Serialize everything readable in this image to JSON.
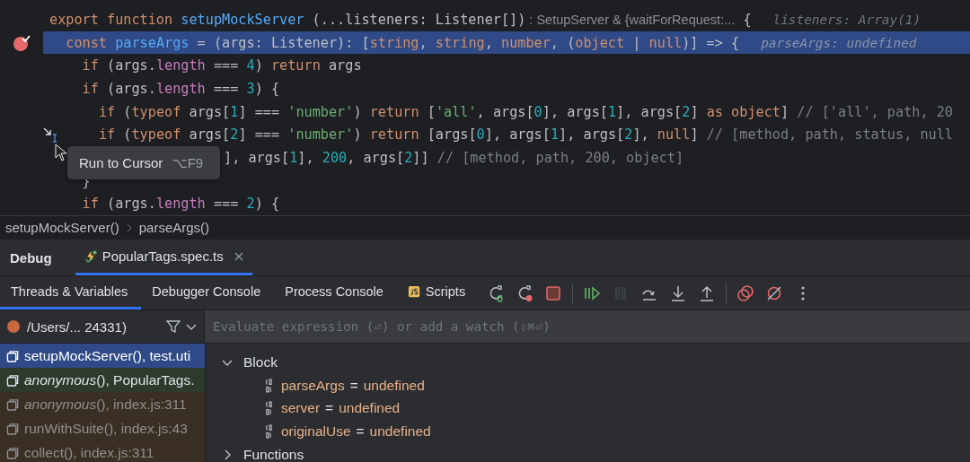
{
  "editor": {
    "lines": [
      {
        "current": false,
        "breakpoint": false,
        "tokens": [
          {
            "kind": "keyword",
            "text": "export function "
          },
          {
            "kind": "function",
            "text": "setupMockServer"
          },
          {
            "kind": "plain",
            "text": " (...listeners: Listener[])"
          },
          {
            "kind": "hint",
            "text": ": SetupServer & {waitForRequest:..."
          },
          {
            "kind": "plain",
            "text": " {"
          },
          {
            "kind": "inline",
            "text": "listeners: Array(1)"
          }
        ]
      },
      {
        "current": true,
        "breakpoint": true,
        "tokens": [
          {
            "kind": "keyword",
            "text": "  const "
          },
          {
            "kind": "function",
            "text": "parseArgs"
          },
          {
            "kind": "plain",
            "text": " = (args: Listener): ["
          },
          {
            "kind": "keyword",
            "text": "string"
          },
          {
            "kind": "plain",
            "text": ", "
          },
          {
            "kind": "keyword",
            "text": "string"
          },
          {
            "kind": "plain",
            "text": ", "
          },
          {
            "kind": "keyword",
            "text": "number"
          },
          {
            "kind": "plain",
            "text": ", ("
          },
          {
            "kind": "keyword",
            "text": "object"
          },
          {
            "kind": "plain",
            "text": " | "
          },
          {
            "kind": "keyword",
            "text": "null"
          },
          {
            "kind": "plain",
            "text": ")] => {"
          },
          {
            "kind": "inline",
            "text": "parseArgs: undefined"
          }
        ]
      },
      {
        "current": false,
        "breakpoint": false,
        "tokens": [
          {
            "kind": "keyword",
            "text": "    if"
          },
          {
            "kind": "plain",
            "text": " (args."
          },
          {
            "kind": "property",
            "text": "length"
          },
          {
            "kind": "plain",
            "text": " === "
          },
          {
            "kind": "number",
            "text": "4"
          },
          {
            "kind": "plain",
            "text": ") "
          },
          {
            "kind": "keyword",
            "text": "return"
          },
          {
            "kind": "plain",
            "text": " args"
          }
        ]
      },
      {
        "current": false,
        "breakpoint": false,
        "tokens": [
          {
            "kind": "keyword",
            "text": "    if"
          },
          {
            "kind": "plain",
            "text": " (args."
          },
          {
            "kind": "property",
            "text": "length"
          },
          {
            "kind": "plain",
            "text": " === "
          },
          {
            "kind": "number",
            "text": "3"
          },
          {
            "kind": "plain",
            "text": ") {"
          }
        ]
      },
      {
        "current": false,
        "breakpoint": false,
        "tokens": [
          {
            "kind": "keyword",
            "text": "      if"
          },
          {
            "kind": "plain",
            "text": " ("
          },
          {
            "kind": "keyword",
            "text": "typeof"
          },
          {
            "kind": "plain",
            "text": " args["
          },
          {
            "kind": "number",
            "text": "1"
          },
          {
            "kind": "plain",
            "text": "] === "
          },
          {
            "kind": "string",
            "text": "'number'"
          },
          {
            "kind": "plain",
            "text": ") "
          },
          {
            "kind": "keyword",
            "text": "return"
          },
          {
            "kind": "plain",
            "text": " ["
          },
          {
            "kind": "string",
            "text": "'all'"
          },
          {
            "kind": "plain",
            "text": ", args["
          },
          {
            "kind": "number",
            "text": "0"
          },
          {
            "kind": "plain",
            "text": "], args["
          },
          {
            "kind": "number",
            "text": "1"
          },
          {
            "kind": "plain",
            "text": "], args["
          },
          {
            "kind": "number",
            "text": "2"
          },
          {
            "kind": "plain",
            "text": "] "
          },
          {
            "kind": "keyword",
            "text": "as object"
          },
          {
            "kind": "plain",
            "text": "] "
          },
          {
            "kind": "comment",
            "text": "// ['all', path, 20"
          }
        ]
      },
      {
        "current": false,
        "breakpoint": false,
        "run_to_cursor": true,
        "tokens": [
          {
            "kind": "keyword",
            "text": "      if"
          },
          {
            "kind": "plain",
            "text": " ("
          },
          {
            "kind": "keyword",
            "text": "typeof"
          },
          {
            "kind": "plain",
            "text": " args["
          },
          {
            "kind": "number",
            "text": "2"
          },
          {
            "kind": "plain",
            "text": "] === "
          },
          {
            "kind": "string",
            "text": "'number'"
          },
          {
            "kind": "plain",
            "text": ") "
          },
          {
            "kind": "keyword",
            "text": "return"
          },
          {
            "kind": "plain",
            "text": " [args["
          },
          {
            "kind": "number",
            "text": "0"
          },
          {
            "kind": "plain",
            "text": "], args["
          },
          {
            "kind": "number",
            "text": "1"
          },
          {
            "kind": "plain",
            "text": "], args["
          },
          {
            "kind": "number",
            "text": "2"
          },
          {
            "kind": "plain",
            "text": "], "
          },
          {
            "kind": "keyword",
            "text": "null"
          },
          {
            "kind": "plain",
            "text": "] "
          },
          {
            "kind": "comment",
            "text": "// [method, path, status, null"
          }
        ]
      },
      {
        "current": false,
        "breakpoint": false,
        "covered": true,
        "tokens": [
          {
            "kind": "plain",
            "text": "], args["
          },
          {
            "kind": "number",
            "text": "1"
          },
          {
            "kind": "plain",
            "text": "], "
          },
          {
            "kind": "number",
            "text": "200"
          },
          {
            "kind": "plain",
            "text": ", args["
          },
          {
            "kind": "number",
            "text": "2"
          },
          {
            "kind": "plain",
            "text": "]] "
          },
          {
            "kind": "comment",
            "text": "// [method, path, 200, object]"
          }
        ]
      },
      {
        "current": false,
        "breakpoint": false,
        "tokens": [
          {
            "kind": "plain",
            "text": "    }"
          }
        ]
      },
      {
        "current": false,
        "breakpoint": false,
        "tokens": [
          {
            "kind": "keyword",
            "text": "    if"
          },
          {
            "kind": "plain",
            "text": " (args."
          },
          {
            "kind": "property",
            "text": "length"
          },
          {
            "kind": "plain",
            "text": " === "
          },
          {
            "kind": "number",
            "text": "2"
          },
          {
            "kind": "plain",
            "text": ") {"
          }
        ]
      }
    ],
    "tooltip": {
      "label": "Run to Cursor",
      "shortcut": "⌥F9"
    }
  },
  "breadcrumbs": [
    "setupMockServer()",
    "parseArgs()"
  ],
  "debug": {
    "title": "Debug",
    "tabs": [
      {
        "label": "PopularTags.spec.ts",
        "selected": true
      }
    ],
    "subtabs": [
      {
        "label": "Threads & Variables",
        "selected": true
      },
      {
        "label": "Debugger Console",
        "selected": false
      },
      {
        "label": "Process Console",
        "selected": false
      },
      {
        "label": "Scripts",
        "selected": false,
        "kind": "js"
      }
    ],
    "toolbar": [
      {
        "kind": "rerun-debug",
        "disabled": false
      },
      {
        "kind": "rerun-error",
        "disabled": false
      },
      {
        "kind": "stop",
        "disabled": false
      },
      {
        "kind": "separator"
      },
      {
        "kind": "resume",
        "disabled": false
      },
      {
        "kind": "pause",
        "disabled": true
      },
      {
        "kind": "step-over",
        "disabled": false
      },
      {
        "kind": "step-into",
        "disabled": false
      },
      {
        "kind": "step-out",
        "disabled": false
      },
      {
        "kind": "separator"
      },
      {
        "kind": "breakpoints",
        "disabled": false
      },
      {
        "kind": "mute",
        "disabled": false
      },
      {
        "kind": "more",
        "disabled": false
      }
    ],
    "thread": {
      "label": "/Users/... 24331)",
      "color": "#c9683f"
    },
    "evaluate": {
      "placeholder": "Evaluate expression (⏎) or add a watch (⇧⌘⏎)"
    },
    "frames": [
      {
        "text": "setupMockServer(), test.uti",
        "kind": "user",
        "selected": true
      },
      {
        "text": "*anonymous*(), PopularTags.",
        "kind": "user",
        "selected": false
      },
      {
        "text": "*anonymous*(), index.js:311",
        "kind": "library",
        "selected": false
      },
      {
        "text": "runWithSuite(), index.js:43",
        "kind": "library",
        "selected": false
      },
      {
        "text": "collect(), index.js:311",
        "kind": "library",
        "selected": false
      }
    ],
    "variables": [
      {
        "label": "Block",
        "expanded": true,
        "children": [
          {
            "name": "parseArgs",
            "operator": "=",
            "value": "undefined"
          },
          {
            "name": "server",
            "operator": "=",
            "value": "undefined"
          },
          {
            "name": "originalUse",
            "operator": "=",
            "value": "undefined"
          }
        ]
      },
      {
        "label": "Functions",
        "expanded": false
      }
    ]
  }
}
